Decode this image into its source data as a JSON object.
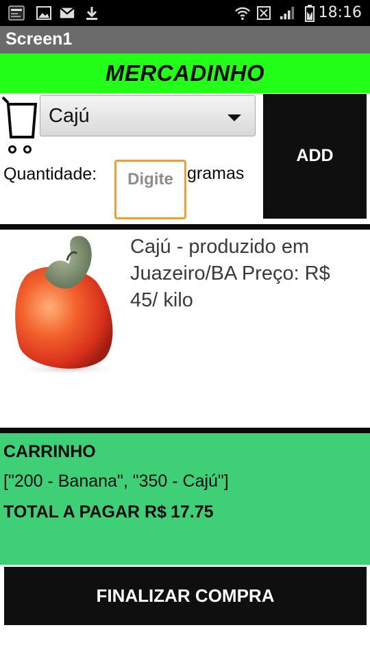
{
  "status_bar": {
    "icons": [
      "news-app-icon",
      "image-icon",
      "gmail-icon",
      "download-icon",
      "wifi-icon",
      "sim-icon",
      "signal-icon",
      "battery-icon"
    ],
    "time": "18:16"
  },
  "app": {
    "title": "Screen1"
  },
  "header": {
    "title": "MERCADINHO",
    "bg_color": "#23ff18"
  },
  "selector": {
    "cart_icon": "shopping-cart-icon",
    "selected_product": "Cajú"
  },
  "quantity": {
    "label": "Quantidade:",
    "placeholder": "Digite",
    "unit": "gramas"
  },
  "add_button": {
    "label": "ADD"
  },
  "product": {
    "image": "cashew-fruit-image",
    "description": "Cajú - produzido em Juazeiro/BA  Preço: R$ 45/ kilo"
  },
  "cart": {
    "title": "CARRINHO",
    "items_text": "[\"200 - Banana\", \"350 - Cajú\"]",
    "total_label": "TOTAL A PAGAR R$",
    "total_value": "17.75",
    "bg_color": "#3fcf77"
  },
  "finish_button": {
    "label": "FINALIZAR COMPRA"
  }
}
